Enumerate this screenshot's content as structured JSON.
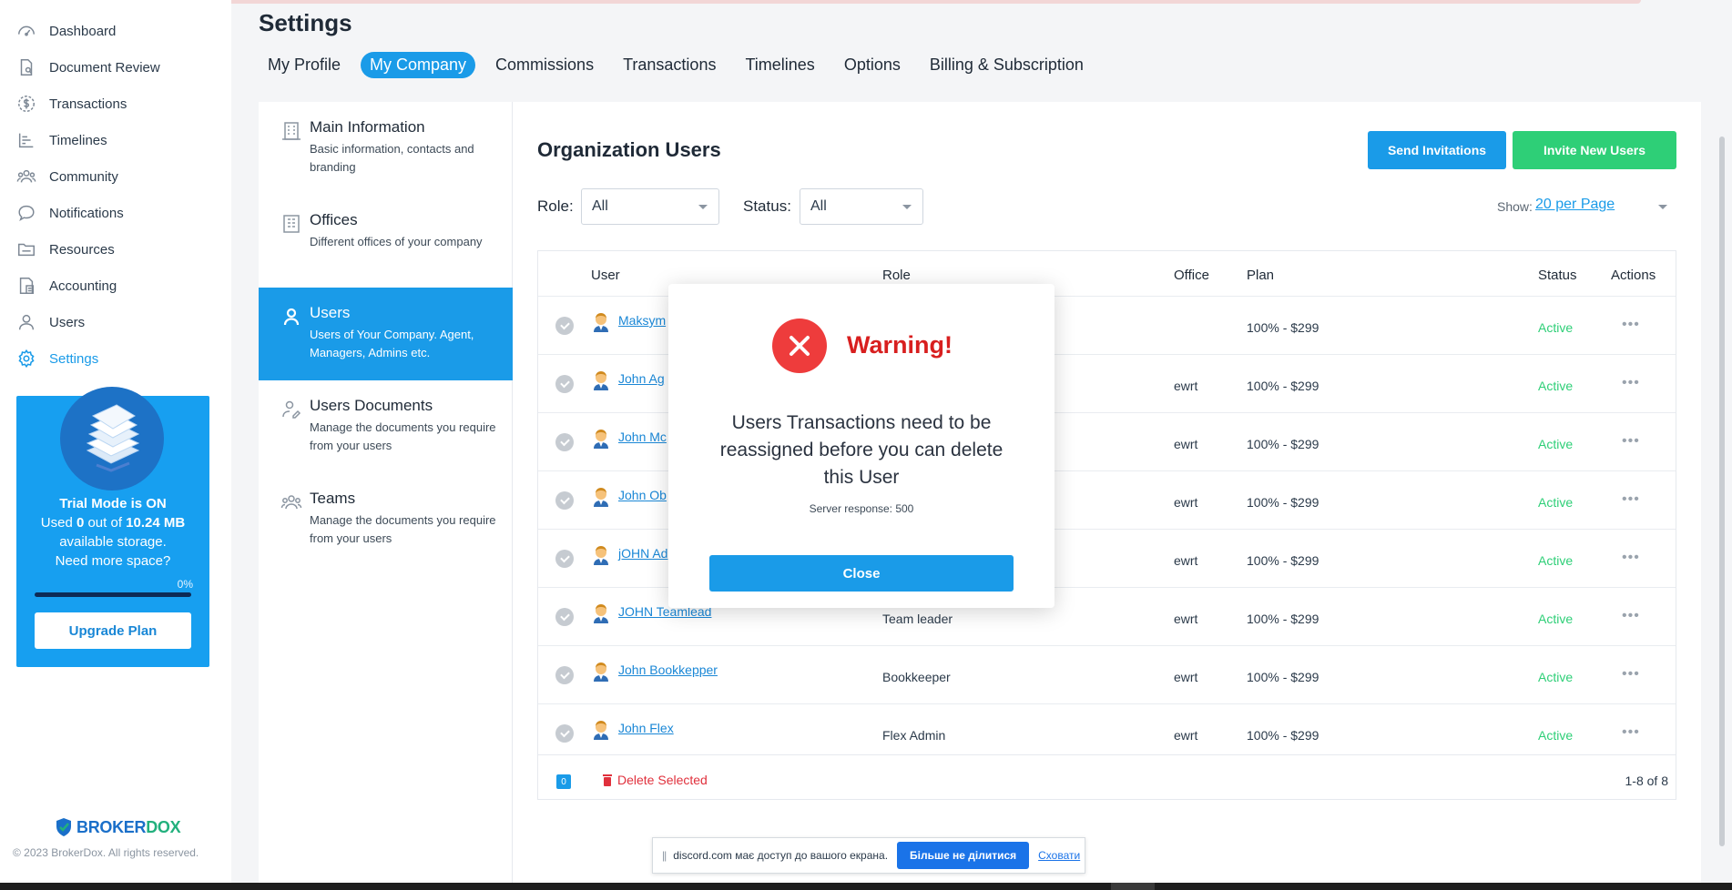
{
  "sidebar": {
    "items": [
      {
        "label": "Dashboard",
        "icon": "dashboard-icon"
      },
      {
        "label": "Document Review",
        "icon": "document-review-icon"
      },
      {
        "label": "Transactions",
        "icon": "dollar-icon"
      },
      {
        "label": "Timelines",
        "icon": "timeline-icon"
      },
      {
        "label": "Community",
        "icon": "community-icon"
      },
      {
        "label": "Notifications",
        "icon": "chat-icon"
      },
      {
        "label": "Resources",
        "icon": "folder-icon"
      },
      {
        "label": "Accounting",
        "icon": "accounting-icon"
      },
      {
        "label": "Users",
        "icon": "user-icon"
      },
      {
        "label": "Settings",
        "icon": "gear-icon"
      }
    ],
    "active_index": 9,
    "trial": {
      "title": "Trial Mode is ON",
      "used_prefix": "Used ",
      "used_value": "0",
      "used_middle": " out of ",
      "used_total": "10.24 MB",
      "line3": "available storage.",
      "line4": "Need more space?",
      "percent_label": "0%",
      "progress": 0,
      "upgrade_label": "Upgrade Plan"
    },
    "brand": {
      "part1": "BROKER",
      "part2": "DOX"
    },
    "copyright": "© 2023 BrokerDox. All rights reserved."
  },
  "page": {
    "title": "Settings",
    "tabs": [
      "My Profile",
      "My Company",
      "Commissions",
      "Transactions",
      "Timelines",
      "Options",
      "Billing & Subscription"
    ],
    "active_tab": 1
  },
  "settings_menu": [
    {
      "title": "Main Information",
      "subtitle": "Basic information, contacts and branding",
      "icon": "building-icon"
    },
    {
      "title": "Offices",
      "subtitle": "Different offices of your company",
      "icon": "office-icon"
    },
    {
      "title": "Users",
      "subtitle": "Users of Your Company. Agent, Managers, Admins etc.",
      "icon": "user-icon"
    },
    {
      "title": "Users Documents",
      "subtitle": "Manage the documents you require from your users",
      "icon": "user-documents-icon"
    },
    {
      "title": "Teams",
      "subtitle": "Manage the documents you require from your users",
      "icon": "teams-icon"
    }
  ],
  "settings_menu_active": 2,
  "org": {
    "title": "Organization Users",
    "send_invitations": "Send Invitations",
    "invite_new_users": "Invite New Users",
    "role_label": "Role:",
    "role_value": "All",
    "status_label": "Status:",
    "status_value": "All",
    "show_label": "Show:",
    "show_value": "20 per Page"
  },
  "table": {
    "columns": [
      "User",
      "Role",
      "Office",
      "Plan",
      "Status",
      "Actions"
    ],
    "rows": [
      {
        "user": "Maksym",
        "role": "",
        "office": "",
        "plan": "100% - $299",
        "status": "Active"
      },
      {
        "user": "John Ag",
        "role": "",
        "office": "ewrt",
        "plan": "100% - $299",
        "status": "Active"
      },
      {
        "user": "John Mc",
        "role": "",
        "office": "ewrt",
        "plan": "100% - $299",
        "status": "Active"
      },
      {
        "user": "John Ob",
        "role": "",
        "office": "ewrt",
        "plan": "100% - $299",
        "status": "Active"
      },
      {
        "user": "jOHN Ad",
        "role": "",
        "office": "ewrt",
        "plan": "100% - $299",
        "status": "Active"
      },
      {
        "user": "JOHN Teamlead",
        "role": "Team leader",
        "office": "ewrt",
        "plan": "100% - $299",
        "status": "Active"
      },
      {
        "user": "John Bookkepper",
        "role": "Bookkeeper",
        "office": "ewrt",
        "plan": "100% - $299",
        "status": "Active"
      },
      {
        "user": "John Flex",
        "role": "Flex Admin",
        "office": "ewrt",
        "plan": "100% - $299",
        "status": "Active"
      }
    ],
    "actions_glyph": "•••",
    "selected_count": "0",
    "delete_selected": "Delete Selected",
    "pagination": "1-8 of 8"
  },
  "modal": {
    "title": "Warning!",
    "message": "Users Transactions need to be reassigned before you can delete this User",
    "server_response": "Server response: 500",
    "close_label": "Close"
  },
  "share_bar": {
    "grip": "||",
    "text": "discord.com має доступ до вашого екрана.",
    "stop_label": "Більше не ділитися",
    "hide_label": "Сховати"
  },
  "colors": {
    "accent": "#1a9be8",
    "success": "#2ecf77",
    "danger": "#ee3c3c"
  }
}
